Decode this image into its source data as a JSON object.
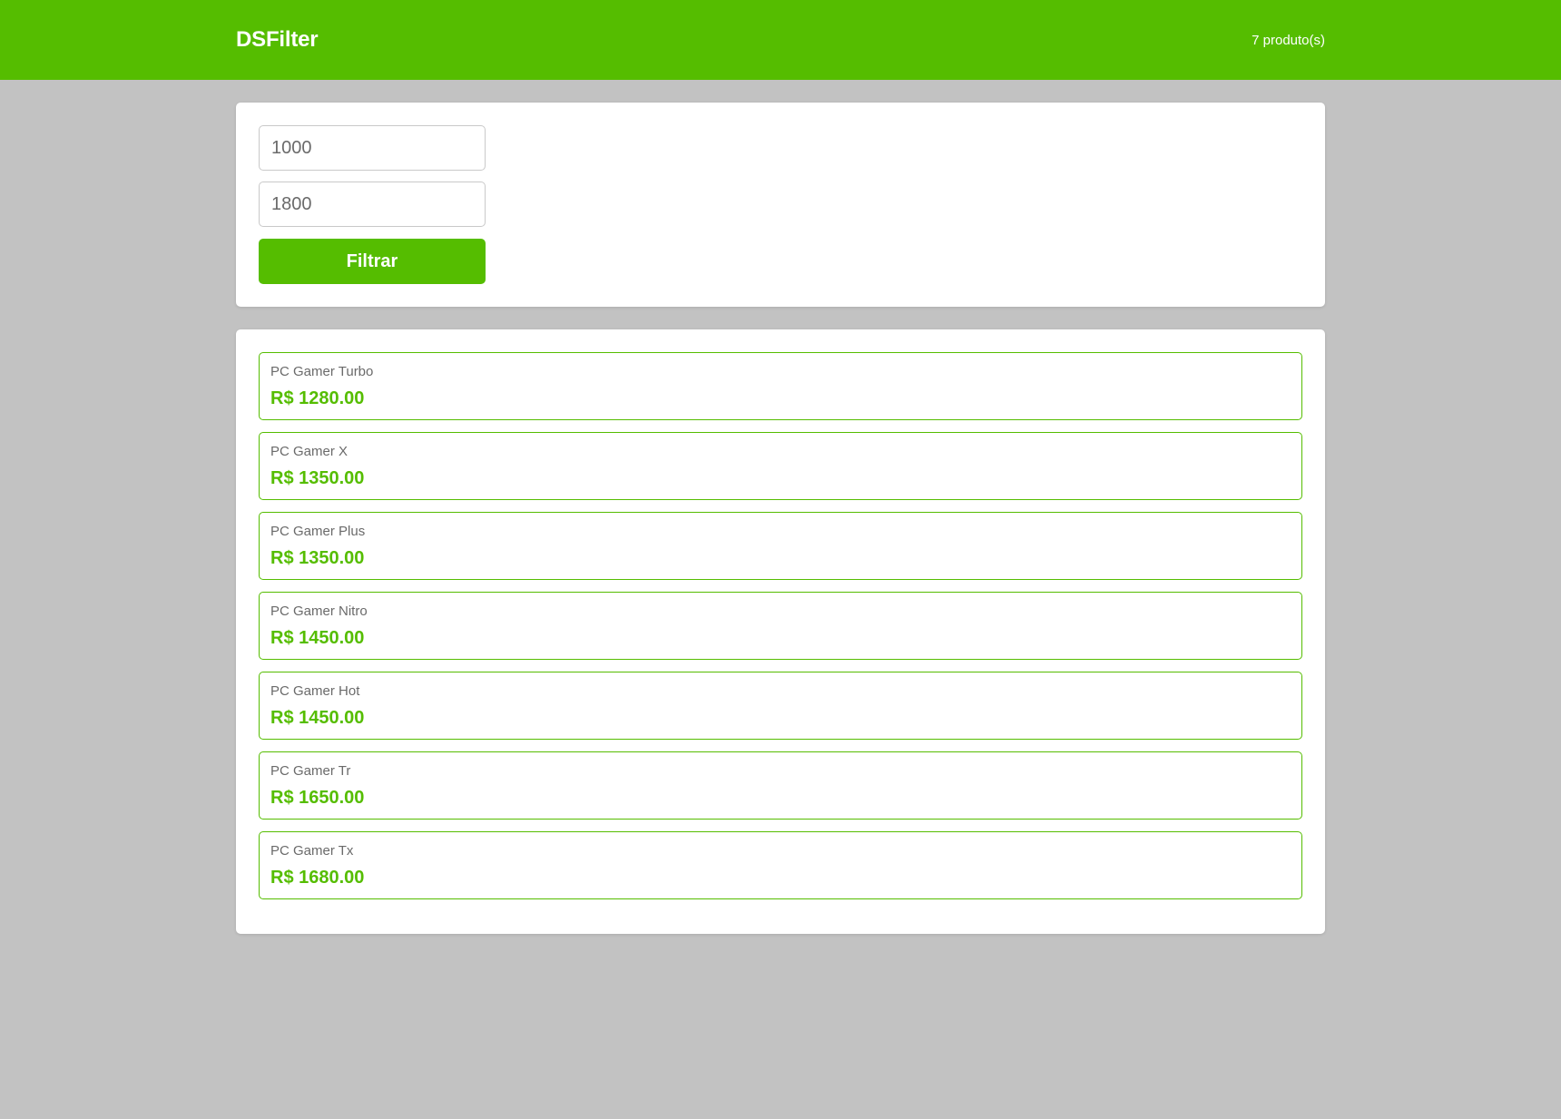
{
  "header": {
    "brand": "DSFilter",
    "product_count": "7 produto(s)"
  },
  "filter": {
    "min_price": "1000",
    "max_price": "1800",
    "button_label": "Filtrar"
  },
  "products": [
    {
      "name": "PC Gamer Turbo",
      "price": "R$ 1280.00"
    },
    {
      "name": "PC Gamer X",
      "price": "R$ 1350.00"
    },
    {
      "name": "PC Gamer Plus",
      "price": "R$ 1350.00"
    },
    {
      "name": "PC Gamer Nitro",
      "price": "R$ 1450.00"
    },
    {
      "name": "PC Gamer Hot",
      "price": "R$ 1450.00"
    },
    {
      "name": "PC Gamer Tr",
      "price": "R$ 1650.00"
    },
    {
      "name": "PC Gamer Tx",
      "price": "R$ 1680.00"
    }
  ],
  "colors": {
    "brand_green": "#55bd00",
    "background": "#c2c2c2",
    "card": "#ffffff",
    "muted_text": "#6a6a6a"
  }
}
